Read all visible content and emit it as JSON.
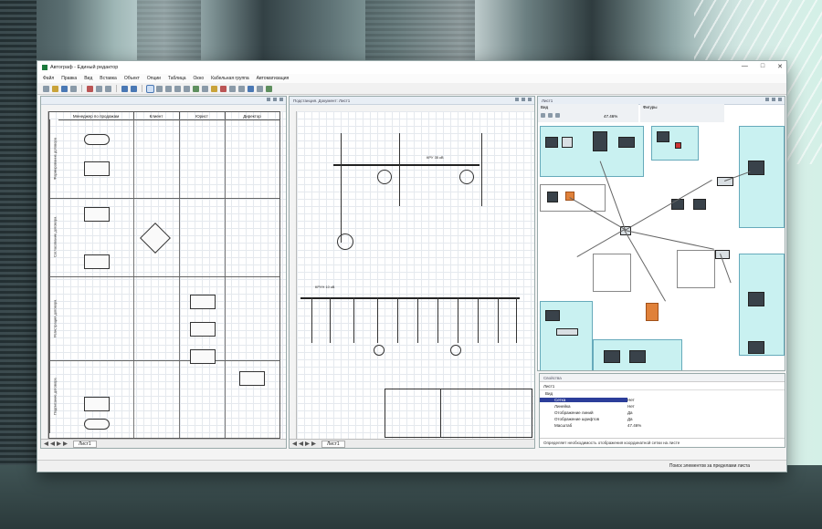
{
  "window": {
    "title": "Автограф - Единый редактор",
    "controls": [
      "—",
      "□",
      "✕"
    ]
  },
  "menu": [
    "Файл",
    "Правка",
    "Вид",
    "Вставка",
    "Объект",
    "Опции",
    "Таблица",
    "Окно",
    "Кабельная группа",
    "Автоматизация"
  ],
  "toolbar_icons": [
    "new-icon",
    "open-icon",
    "save-icon",
    "print-icon",
    "cut-icon",
    "copy-icon",
    "paste-icon",
    "undo-icon",
    "redo-icon",
    "pointer-icon",
    "text-icon",
    "line-icon",
    "rectangle-icon",
    "ellipse-icon",
    "zoom-icon",
    "grid-icon",
    "layers-icon",
    "align-icon"
  ],
  "pane1": {
    "title": "",
    "lane_headers": [
      "Менеджер по продажам",
      "Клиент",
      "Юрист",
      "Директор"
    ],
    "row_labels": [
      "Формирование договора",
      "Согласование договора",
      "Регистрация договора",
      "Подписание договора"
    ],
    "sheet_tab": "Лист1"
  },
  "pane2": {
    "title": "Подстанция. Документ: Лист1",
    "labels": [
      "КРУ 35 кВ",
      "КРУН 10 кВ"
    ],
    "sheet_tab": "Лист1"
  },
  "pane3": {
    "title": "Лист1",
    "view_label": "Вид",
    "figures_label": "Фигуры",
    "zoom": "47.46%"
  },
  "properties": {
    "title": "Свойства",
    "selector": "Лист1",
    "group": "Вид",
    "rows": [
      {
        "key": "Сетка",
        "value": "Нет"
      },
      {
        "key": "Линейка",
        "value": "Нет"
      },
      {
        "key": "Отображение линий",
        "value": "Да"
      },
      {
        "key": "Отображение шрифтов",
        "value": "Да"
      },
      {
        "key": "Масштаб",
        "value": "47.46%"
      }
    ],
    "description": "Определяет необходимость отображения координатной сетки на листе"
  },
  "status": {
    "text": "Поиск элементов за пределами листа"
  },
  "colors": {
    "accent": "#2c3e9a",
    "net_zone": "#c9f1f1",
    "brand": "#1c7a3c"
  }
}
